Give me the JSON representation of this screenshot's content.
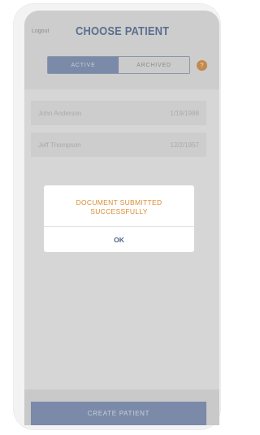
{
  "header": {
    "logout_label": "Logout",
    "title": "CHOOSE PATIENT",
    "help_glyph": "?"
  },
  "tabs": [
    {
      "label": "ACTIVE",
      "selected": true
    },
    {
      "label": "ARCHIVED",
      "selected": false
    }
  ],
  "patients": [
    {
      "name": "John Anderson",
      "dob": "1/19/1988"
    },
    {
      "name": "Jeff Thompson",
      "dob": "12/2/1957"
    }
  ],
  "dialog": {
    "message_line1": "DOCUMENT SUBMITTED",
    "message_line2": "SUCCESSFULLY",
    "ok_label": "OK"
  },
  "footer": {
    "create_label": "CREATE PATIENT"
  },
  "colors": {
    "accent": "#5b6f8e",
    "message": "#d98c34",
    "help_badge": "#c4894c"
  }
}
